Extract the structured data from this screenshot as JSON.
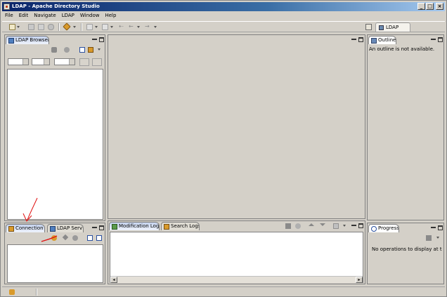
{
  "window": {
    "title": "LDAP - Apache Directory Studio",
    "minimize_label": "_",
    "maximize_label": "□",
    "close_label": "×"
  },
  "menu": [
    "File",
    "Edit",
    "Navigate",
    "LDAP",
    "Window",
    "Help"
  ],
  "perspective": {
    "label": "LDAP"
  },
  "ldap_browser": {
    "tab": "LDAP Browser"
  },
  "outline": {
    "tab": "Outline",
    "message": "An outline is not available."
  },
  "connections": {
    "tabs": [
      "Connection",
      "LDAP Serv"
    ]
  },
  "logs": {
    "tabs": [
      "Modification Logs",
      "Search Logs"
    ]
  },
  "progress": {
    "tab": "Progress",
    "message": "No operations to display at this tin"
  },
  "scroll": {
    "left_label": "◂",
    "right_label": "▸"
  },
  "colors": {
    "icon_blue": "#4f7fbf",
    "icon_orange": "#d99a2b",
    "icon_green": "#5a9a4a",
    "icon_gray": "#8a8a8a",
    "annotation_red": "#e01010"
  }
}
